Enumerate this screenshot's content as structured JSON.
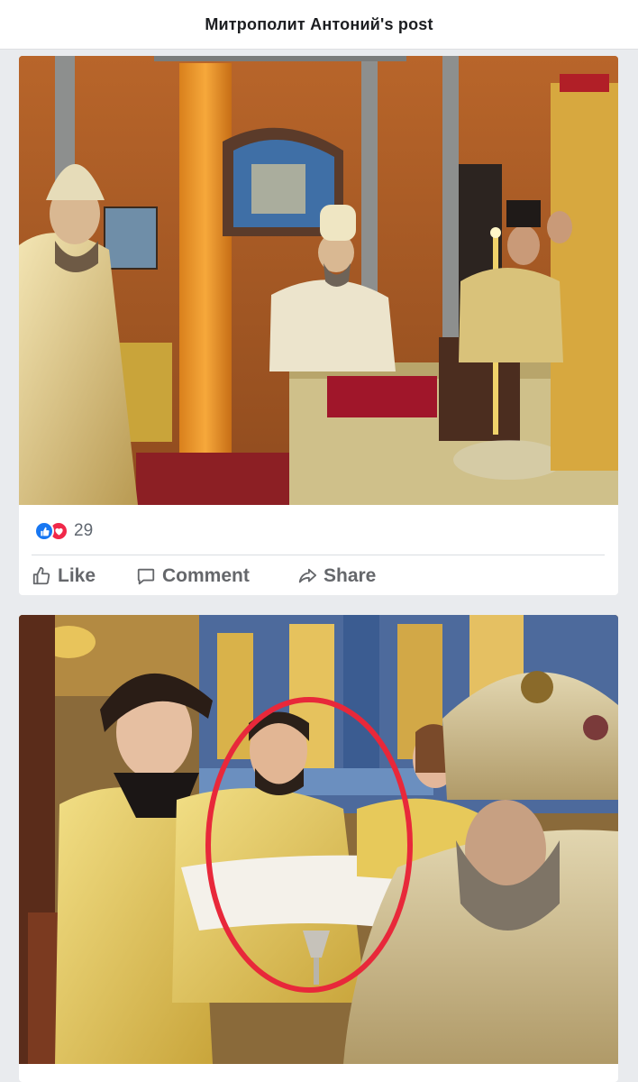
{
  "header": {
    "title": "Митрополит Антоний's post"
  },
  "posts": [
    {
      "reactions": {
        "icons": [
          "like-icon",
          "love-icon"
        ],
        "count": "29"
      },
      "actions": {
        "like": "Like",
        "comment": "Comment",
        "share": "Share"
      }
    },
    {
      "highlight": {
        "shape": "ellipse",
        "color": "#e8283a"
      }
    }
  ],
  "colors": {
    "like_blue": "#1877f2",
    "love_red": "#f02849",
    "action_gray": "#65676b",
    "page_bg": "#e9ebee"
  }
}
